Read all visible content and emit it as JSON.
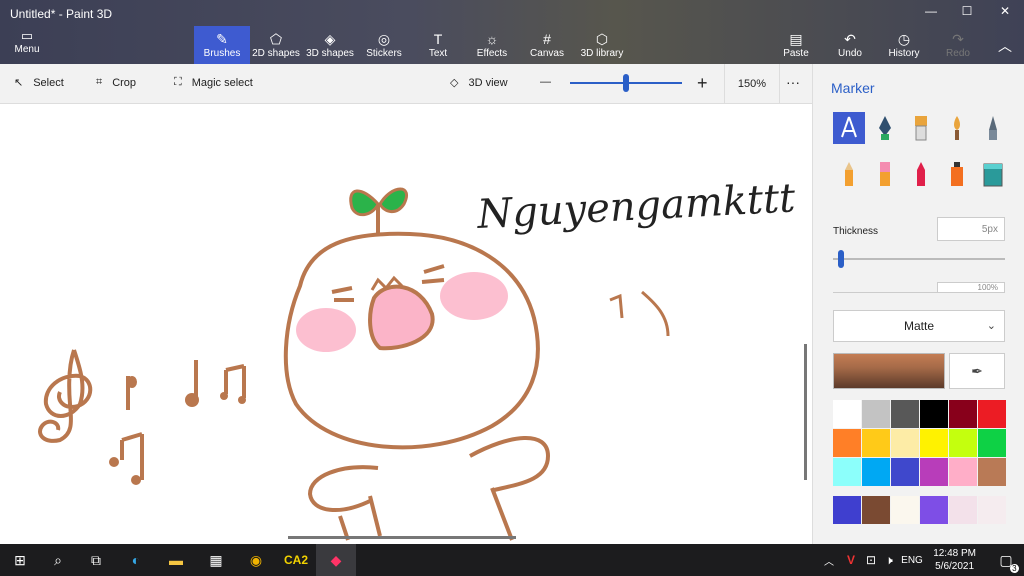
{
  "window": {
    "title": "Untitled* - Paint 3D",
    "minimize": "—",
    "maximize": "☐",
    "close": "✕"
  },
  "ribbon": {
    "menu_label": "Menu",
    "tools": [
      {
        "label": "Brushes",
        "icon": "✎"
      },
      {
        "label": "2D shapes",
        "icon": "⬠"
      },
      {
        "label": "3D shapes",
        "icon": "◈"
      },
      {
        "label": "Stickers",
        "icon": "◎"
      },
      {
        "label": "Text",
        "icon": "T"
      },
      {
        "label": "Effects",
        "icon": "☼"
      },
      {
        "label": "Canvas",
        "icon": "#"
      },
      {
        "label": "3D library",
        "icon": "⬡"
      }
    ],
    "paste": "Paste",
    "undo": "Undo",
    "history": "History",
    "redo": "Redo"
  },
  "toolbar2": {
    "select": "Select",
    "crop": "Crop",
    "magic_select": "Magic select",
    "view3d": "3D view",
    "zoom_minus": "—",
    "zoom_plus": "+",
    "zoom_level": "150%",
    "more": "···"
  },
  "zoom_slider_fraction": 0.5,
  "canvas": {
    "signature": "Nguyengamkttt"
  },
  "panel": {
    "title": "Marker",
    "brushes": [
      "marker",
      "calligraphy-pen",
      "oil-brush",
      "watercolor",
      "pixel-pen",
      "pencil",
      "eraser",
      "crayon",
      "spray-can",
      "fill"
    ],
    "thickness_label": "Thickness",
    "thickness_value": "5px",
    "thickness_fraction": 0.03,
    "opacity_value": "100%",
    "finish": "Matte",
    "current_color": "#a56a48",
    "palette": [
      "#ffffff",
      "#c3c3c3",
      "#585858",
      "#000000",
      "#88001b",
      "#ec1c24",
      "#ff7f27",
      "#ffca18",
      "#fdeca6",
      "#fff200",
      "#c4ff0e",
      "#0ed145",
      "#8cfffb",
      "#00a8f3",
      "#3f48cc",
      "#b83dba",
      "#ffaec8",
      "#b97a56"
    ],
    "custom": [
      "#3f3fcf",
      "#7a4a32",
      "#fbf7ee",
      "#7e4ee6",
      "#f3e1ea",
      "#f5ecef"
    ]
  },
  "taskbar": {
    "time": "12:48 PM",
    "date": "5/6/2021",
    "lang": "ENG",
    "notif": "3"
  }
}
